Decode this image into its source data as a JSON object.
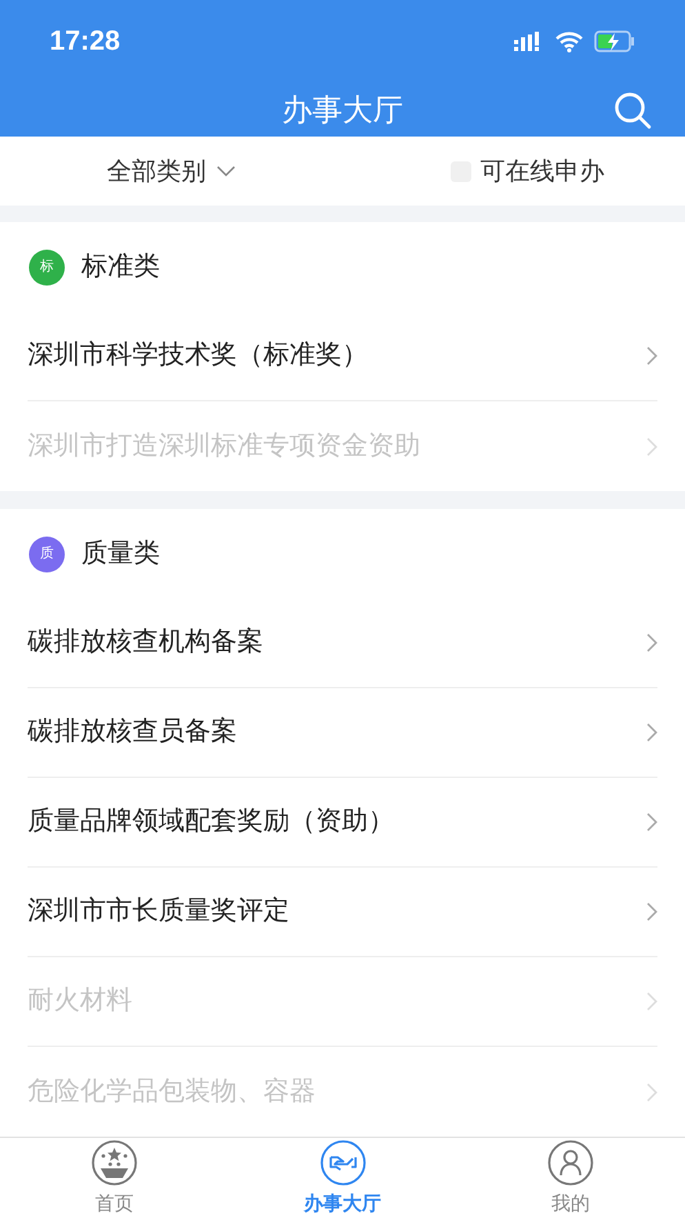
{
  "status_bar": {
    "time": "17:28"
  },
  "header": {
    "title": "办事大厅"
  },
  "filters": {
    "category": {
      "label": "全部类别"
    },
    "online_only": {
      "label": "可在线申办",
      "checked": false
    }
  },
  "sections": [
    {
      "title": "标准类",
      "badge": "标",
      "color": "#2fb14a",
      "items": [
        {
          "label": "深圳市科学技术奖（标准奖）",
          "disabled": false
        },
        {
          "label": "深圳市打造深圳标准专项资金资助",
          "disabled": true
        }
      ]
    },
    {
      "title": "质量类",
      "badge": "质",
      "color": "#7b6cf0",
      "items": [
        {
          "label": "碳排放核查机构备案",
          "disabled": false
        },
        {
          "label": "碳排放核查员备案",
          "disabled": false
        },
        {
          "label": "质量品牌领域配套奖励（资助）",
          "disabled": false
        },
        {
          "label": "深圳市市长质量奖评定",
          "disabled": false
        },
        {
          "label": "耐火材料",
          "disabled": true
        },
        {
          "label": "危险化学品包装物、容器",
          "disabled": true
        }
      ]
    }
  ],
  "tab_bar": [
    {
      "label": "首页",
      "kind": "home",
      "selected": false
    },
    {
      "label": "办事大厅",
      "kind": "hall",
      "selected": true
    },
    {
      "label": "我的",
      "kind": "profile",
      "selected": false
    }
  ]
}
